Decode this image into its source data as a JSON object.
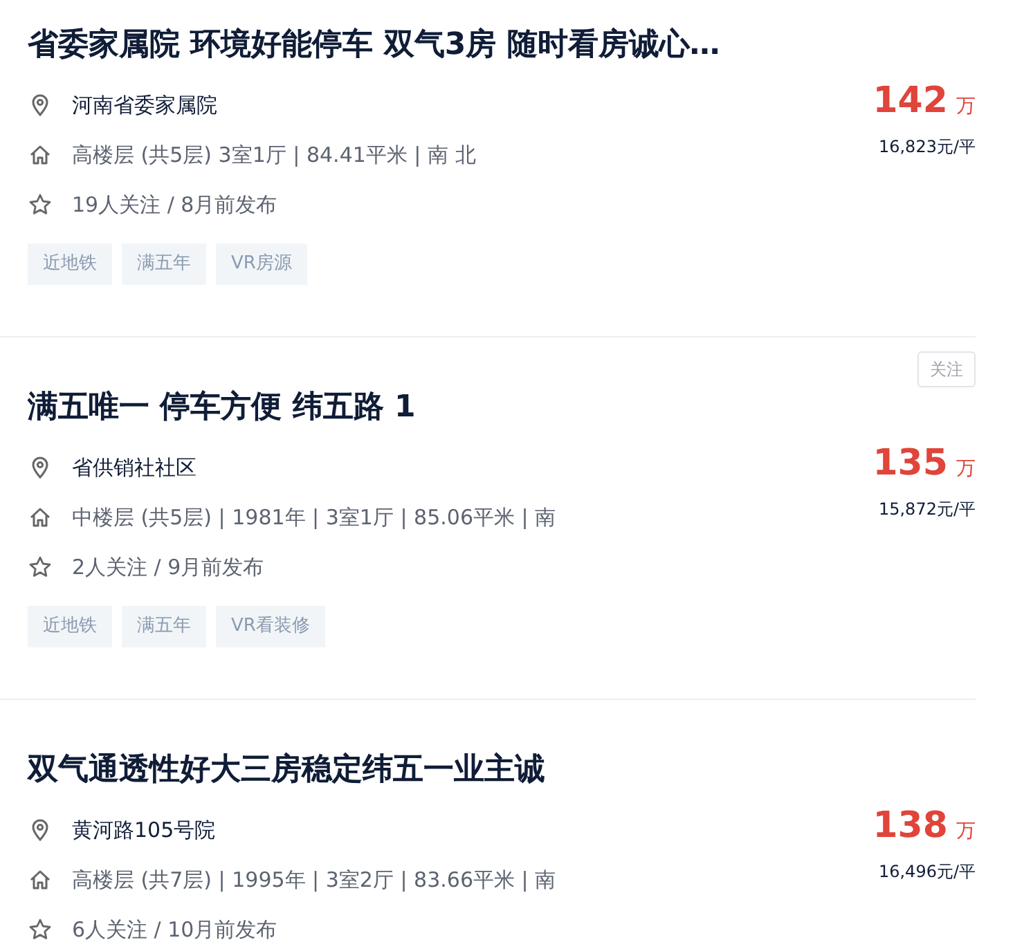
{
  "listings": [
    {
      "title": "省委家属院 环境好能停车 双气3房 随时看房诚心…",
      "location": "河南省委家属院",
      "details": "高楼层 (共5层) 3室1厅 | 84.41平米 | 南 北",
      "stats": "19人关注 / 8月前发布",
      "price": "142",
      "price_unit": "万",
      "unit_price": "16,823元/平",
      "tags": [
        "近地铁",
        "满五年",
        "VR房源"
      ]
    },
    {
      "title": "满五唯一 停车方便 纬五路 1",
      "follow": "关注",
      "location": "省供销社社区",
      "details": "中楼层 (共5层) | 1981年 | 3室1厅 | 85.06平米 | 南",
      "stats": "2人关注 / 9月前发布",
      "price": "135",
      "price_unit": "万",
      "unit_price": "15,872元/平",
      "tags": [
        "近地铁",
        "满五年",
        "VR看装修"
      ]
    },
    {
      "title": "双气通透性好大三房稳定纬五一业主诚",
      "location": "黄河路105号院",
      "details": "高楼层 (共7层) | 1995年 | 3室2厅 | 83.66平米 | 南",
      "stats": "6人关注 / 10月前发布",
      "price": "138",
      "price_unit": "万",
      "unit_price": "16,496元/平"
    }
  ]
}
